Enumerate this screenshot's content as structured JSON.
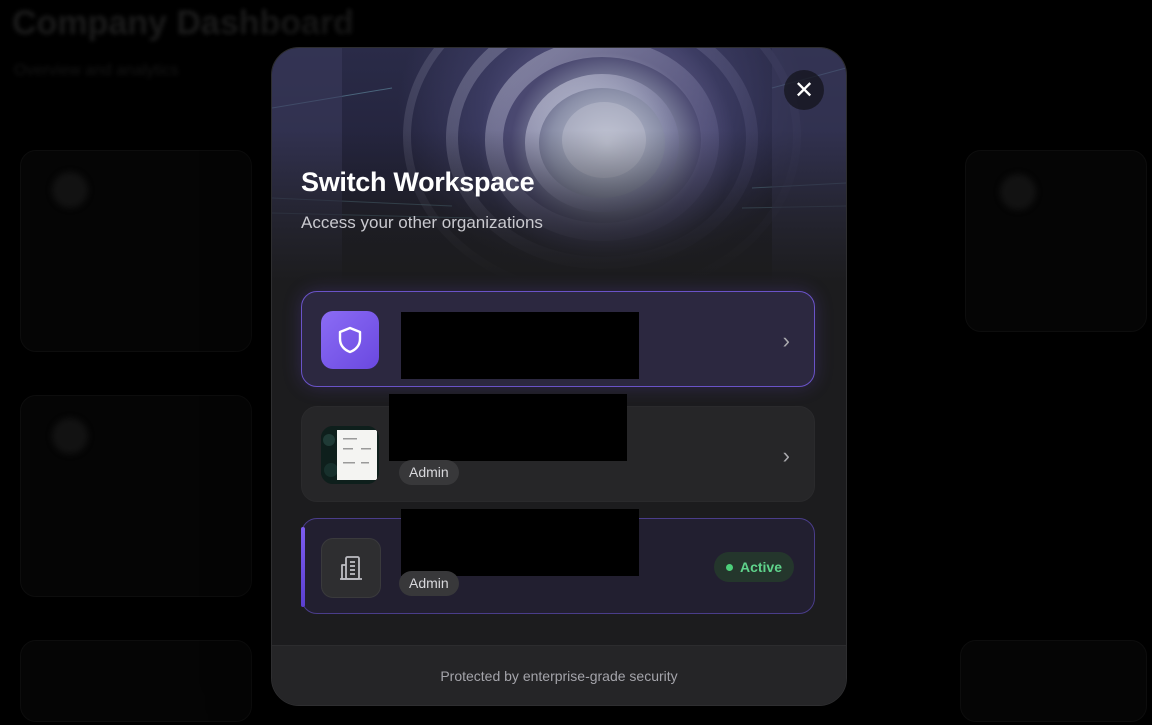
{
  "background": {
    "title": "Company Dashboard",
    "subtitle": "Overview and analytics"
  },
  "modal": {
    "title": "Switch Workspace",
    "subtitle": "Access your other organizations",
    "close_icon": "close-icon",
    "workspaces": [
      {
        "icon": "shield-icon",
        "role": "",
        "status": ""
      },
      {
        "icon": "workspace-thumbnail",
        "role": "Admin",
        "status": ""
      },
      {
        "icon": "building-icon",
        "role": "Admin",
        "status": "Active"
      }
    ],
    "footer": "Protected by enterprise-grade security"
  },
  "colors": {
    "accent": "#7c5cf0",
    "active_green": "#5fd38b",
    "modal_bg": "#1c1c1e"
  }
}
